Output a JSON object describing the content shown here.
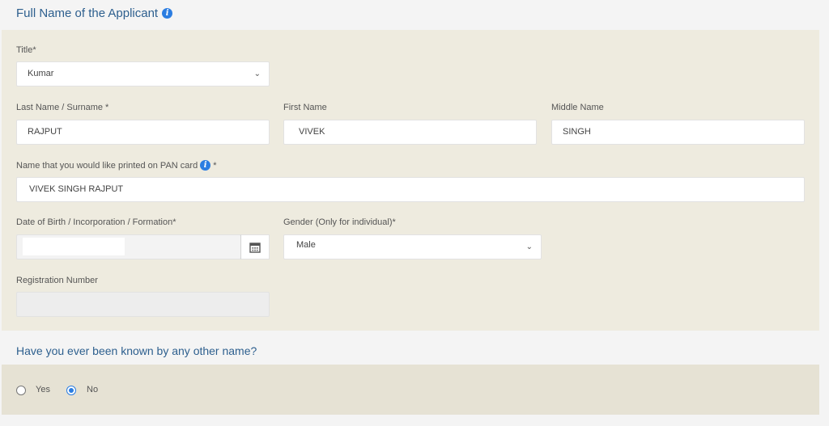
{
  "section": {
    "title": "Full Name of the Applicant",
    "info_glyph": "i"
  },
  "form": {
    "title_field": {
      "label": "Title*",
      "value": "Kumar"
    },
    "last_name": {
      "label": "Last Name / Surname *",
      "value": "RAJPUT"
    },
    "first_name": {
      "label": "First Name",
      "value": "VIVEK"
    },
    "middle_name": {
      "label": "Middle Name",
      "value": "SINGH"
    },
    "pan_name": {
      "label": "Name that you would like printed on PAN card",
      "required_mark": "*",
      "value": "VIVEK SINGH RAJPUT"
    },
    "dob": {
      "label": "Date of Birth / Incorporation / Formation*",
      "value": ""
    },
    "gender": {
      "label": "Gender (Only for individual)*",
      "value": "Male"
    },
    "registration": {
      "label": "Registration Number",
      "value": ""
    }
  },
  "other_name": {
    "question": "Have you ever been known by any other name?",
    "options": [
      {
        "label": "Yes",
        "checked": false
      },
      {
        "label": "No",
        "checked": true
      }
    ]
  },
  "colors": {
    "accent": "#2b7de1",
    "heading": "#2d5f8e",
    "panel": "#eeebdf"
  },
  "icons": {
    "dropdown": "chevron-down-icon",
    "calendar": "calendar-icon",
    "info": "info-icon"
  }
}
